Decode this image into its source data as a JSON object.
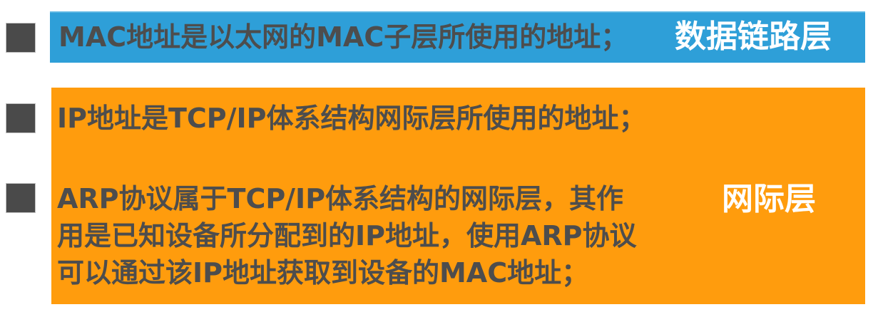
{
  "rows": {
    "mac": {
      "text": "MAC地址是以太网的MAC子层所使用的地址；",
      "tag": "数据链路层"
    },
    "ip": {
      "text": "IP地址是TCP/IP体系结构网际层所使用的地址；"
    },
    "arp": {
      "lines": [
        "ARP协议属于TCP/IP体系结构的网际层，其作",
        "用是已知设备所分配到的IP地址，使用ARP协议",
        "可以通过该IP地址获取到设备的MAC地址；"
      ],
      "tag": "网际层"
    }
  },
  "colors": {
    "blue_band": "#2e9fd8",
    "orange_block": "#ff9c0d",
    "text": "#4d4d4d",
    "bullet": "#4a4a4a",
    "tag_text": "#ffffff"
  }
}
